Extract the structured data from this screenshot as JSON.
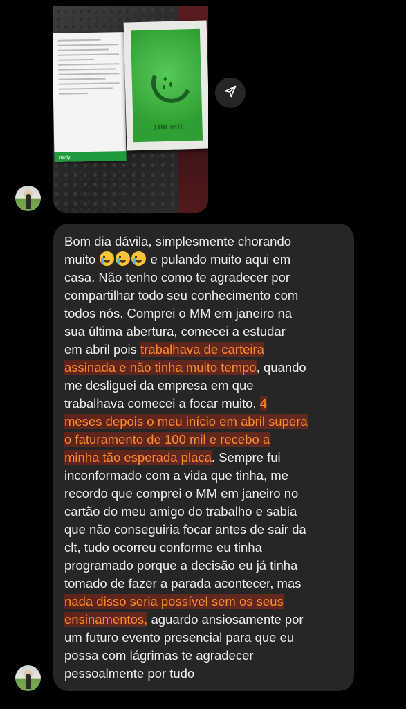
{
  "photo": {
    "certificate_value": "100 mil",
    "document_brand": "kiwify"
  },
  "message": {
    "lines": [
      {
        "segments": [
          {
            "text": "Bom dia dávila, simplesmente chorando",
            "hl": false
          }
        ]
      },
      {
        "segments": [
          {
            "text": "muito ",
            "hl": false
          },
          {
            "emoji": "crying-face"
          },
          {
            "emoji": "crying-face"
          },
          {
            "emoji": "crying-face"
          },
          {
            "text": " e pulando muito aqui em",
            "hl": false
          }
        ]
      },
      {
        "segments": [
          {
            "text": "casa. Não tenho como te agradecer por",
            "hl": false
          }
        ]
      },
      {
        "segments": [
          {
            "text": "compartilhar todo seu conhecimento com",
            "hl": false
          }
        ]
      },
      {
        "segments": [
          {
            "text": "todos nós. Comprei o MM em janeiro na",
            "hl": false
          }
        ]
      },
      {
        "segments": [
          {
            "text": "sua última abertura, comecei a estudar",
            "hl": false
          }
        ]
      },
      {
        "segments": [
          {
            "text": "em abril pois ",
            "hl": false
          },
          {
            "text": "trabalhava de carteira",
            "hl": true
          }
        ]
      },
      {
        "segments": [
          {
            "text": "assinada e não tinha muito tempo",
            "hl": true
          },
          {
            "text": ", quando",
            "hl": false
          }
        ]
      },
      {
        "segments": [
          {
            "text": "me desliguei da empresa em que",
            "hl": false
          }
        ]
      },
      {
        "segments": [
          {
            "text": "trabalhava comecei a focar muito, ",
            "hl": false
          },
          {
            "text": "4",
            "hl": true
          }
        ]
      },
      {
        "segments": [
          {
            "text": "meses depois o meu início em abril supera",
            "hl": true
          }
        ]
      },
      {
        "segments": [
          {
            "text": "o faturamento de 100 mil e recebo a",
            "hl": true
          }
        ]
      },
      {
        "segments": [
          {
            "text": "minha tão esperada placa",
            "hl": true
          },
          {
            "text": ". Sempre fui",
            "hl": false
          }
        ]
      },
      {
        "segments": [
          {
            "text": "inconformado com a vida que tinha, me",
            "hl": false
          }
        ]
      },
      {
        "segments": [
          {
            "text": "recordo que comprei o MM em janeiro no",
            "hl": false
          }
        ]
      },
      {
        "segments": [
          {
            "text": "cartão do meu amigo do trabalho e sabia",
            "hl": false
          }
        ]
      },
      {
        "segments": [
          {
            "text": "que não conseguiria focar antes de sair da",
            "hl": false
          }
        ]
      },
      {
        "segments": [
          {
            "text": "clt, tudo ocorreu conforme eu tinha",
            "hl": false
          }
        ]
      },
      {
        "segments": [
          {
            "text": "programado porque a decisão eu já tinha",
            "hl": false
          }
        ]
      },
      {
        "segments": [
          {
            "text": "tomado de fazer a parada acontecer, mas",
            "hl": false
          }
        ]
      },
      {
        "segments": [
          {
            "text": "nada disso seria possível sem os seus",
            "hl": true
          }
        ]
      },
      {
        "segments": [
          {
            "text": "ensinamentos,",
            "hl": true
          },
          {
            "text": " aguardo ansiosamente por",
            "hl": false
          }
        ]
      },
      {
        "segments": [
          {
            "text": "um futuro evento presencial para que eu",
            "hl": false
          }
        ]
      },
      {
        "segments": [
          {
            "text": "possa com lágrimas te agradecer",
            "hl": false
          }
        ]
      },
      {
        "segments": [
          {
            "text": "pessoalmente por tudo",
            "hl": false
          }
        ]
      }
    ]
  },
  "icons": {
    "share": "send-icon",
    "emoji": "crying-face-emoji"
  },
  "colors": {
    "background": "#000000",
    "bubble": "#262626",
    "highlight_text": "#ff8a2e",
    "text": "#ededed"
  }
}
